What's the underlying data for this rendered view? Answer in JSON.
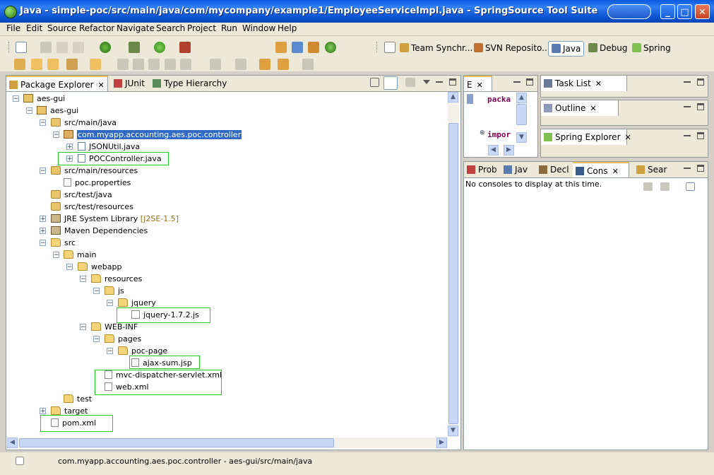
{
  "window": {
    "title": "Java - simple-poc/src/main/java/com/mycompany/example1/EmployeeServiceImpl.java - SpringSource Tool Suite",
    "min_label": "_",
    "max_label": "□",
    "close_label": "✕"
  },
  "menu": [
    "File",
    "Edit",
    "Source",
    "Refactor",
    "Navigate",
    "Search",
    "Project",
    "Run",
    "Window",
    "Help"
  ],
  "perspectives": {
    "team": "Team Synchr...",
    "svn": "SVN Reposito...",
    "java": "Java",
    "debug": "Debug",
    "spring": "Spring"
  },
  "left_panel": {
    "tabs": [
      "Package Explorer",
      "JUnit",
      "Type Hierarchy"
    ]
  },
  "tree": [
    {
      "label": "aes-gui",
      "suffix": ""
    },
    {
      "label": "aes-gui",
      "suffix": ""
    },
    {
      "label": "src/main/java",
      "suffix": ""
    },
    {
      "label": "com.myapp.accounting.aes.poc.controller",
      "suffix": ""
    },
    {
      "label": "JSONUtil.java",
      "suffix": ""
    },
    {
      "label": "POCController.java",
      "suffix": ""
    },
    {
      "label": "src/main/resources",
      "suffix": ""
    },
    {
      "label": "poc.properties",
      "suffix": ""
    },
    {
      "label": "src/test/java",
      "suffix": ""
    },
    {
      "label": "src/test/resources",
      "suffix": ""
    },
    {
      "label": "JRE System Library",
      "suffix": " [J2SE-1.5]"
    },
    {
      "label": "Maven Dependencies",
      "suffix": ""
    },
    {
      "label": "src",
      "suffix": ""
    },
    {
      "label": "main",
      "suffix": ""
    },
    {
      "label": "webapp",
      "suffix": ""
    },
    {
      "label": "resources",
      "suffix": ""
    },
    {
      "label": "js",
      "suffix": ""
    },
    {
      "label": "jquery",
      "suffix": ""
    },
    {
      "label": "jquery-1.7.2.js",
      "suffix": ""
    },
    {
      "label": "WEB-INF",
      "suffix": ""
    },
    {
      "label": "pages",
      "suffix": ""
    },
    {
      "label": "poc-page",
      "suffix": ""
    },
    {
      "label": "ajax-sum.jsp",
      "suffix": ""
    },
    {
      "label": "mvc-dispatcher-servlet.xml",
      "suffix": ""
    },
    {
      "label": "web.xml",
      "suffix": ""
    },
    {
      "label": "test",
      "suffix": ""
    },
    {
      "label": "target",
      "suffix": ""
    },
    {
      "label": "pom.xml",
      "suffix": ""
    }
  ],
  "editor": {
    "tab": "E",
    "line1": "packa",
    "line2": "impor"
  },
  "right_panels": {
    "task_list": "Task List",
    "outline": "Outline",
    "spring_explorer": "Spring Explorer"
  },
  "bottom_tabs": [
    "Prob",
    "Jav",
    "Decl",
    "Cons",
    "Sear"
  ],
  "console_text": "No consoles to display at this time.",
  "status": "com.myapp.accounting.aes.poc.controller - aes-gui/src/main/java",
  "colors": {
    "titlebar": "#0a5ae0",
    "selection": "#316ac5",
    "highlight_box": "#22cc22"
  }
}
